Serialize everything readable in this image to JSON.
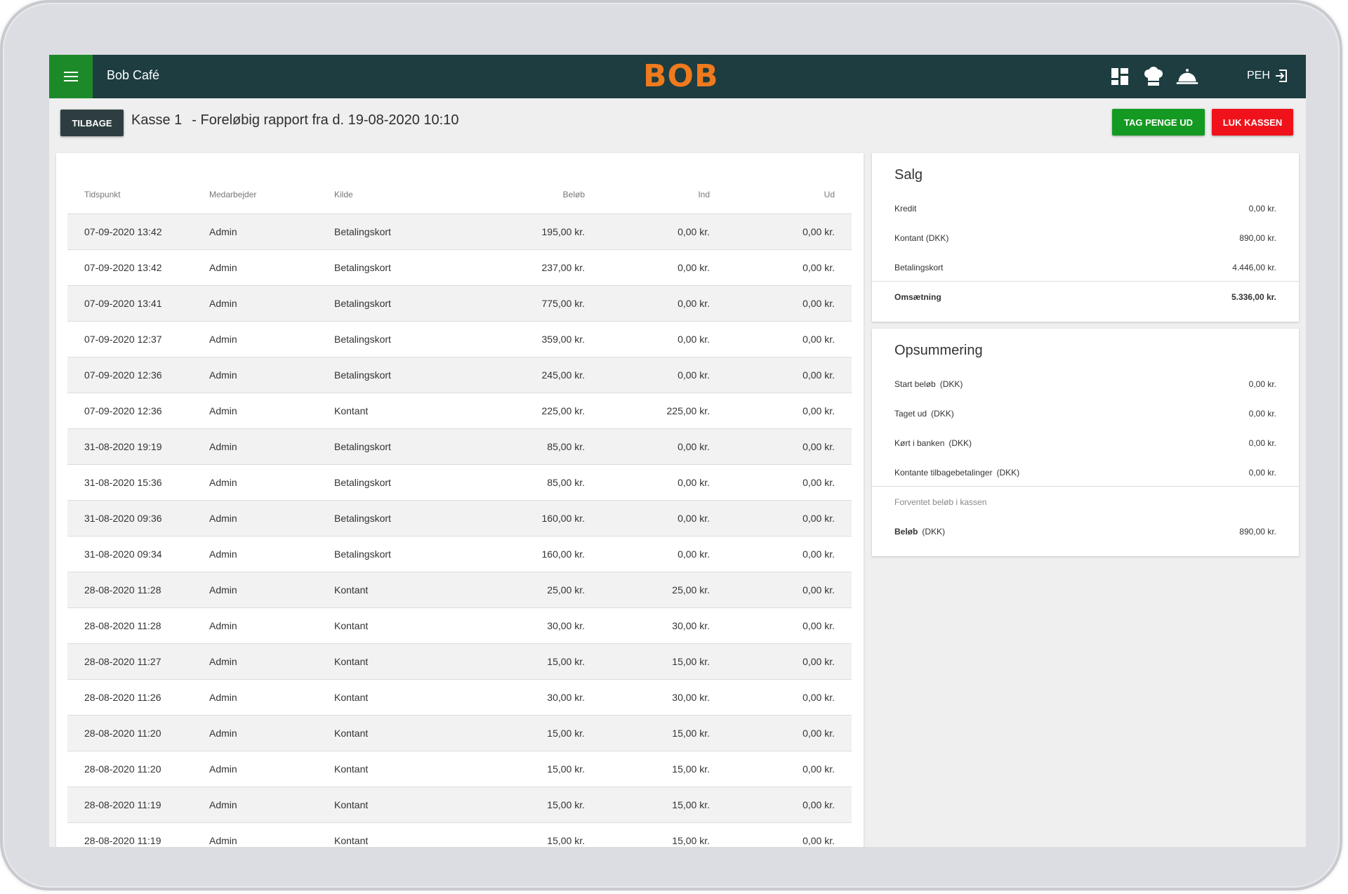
{
  "app": {
    "title": "Bob Café",
    "logo": "BOB",
    "user": "PEH",
    "icons": [
      "dashboard-icon",
      "chef-hat-icon",
      "service-bell-icon",
      "logout-icon"
    ]
  },
  "header": {
    "back_label": "TILBAGE",
    "register": "Kasse 1",
    "report_title": "- Foreløbig rapport fra d. 19-08-2020 10:10",
    "take_money_label": "TAG PENGE UD",
    "close_register_label": "LUK KASSEN"
  },
  "colors": {
    "topbar": "#1d3d40",
    "menu_button": "#1d8a2a",
    "logo": "#f07a1e",
    "green_button": "#149a22",
    "red_button": "#f0121b"
  },
  "table": {
    "columns": [
      "Tidspunkt",
      "Medarbejder",
      "Kilde",
      "Beløb",
      "Ind",
      "Ud"
    ],
    "rows": [
      {
        "time": "07-09-2020 13:42",
        "employee": "Admin",
        "source": "Betalingskort",
        "amount": "195,00 kr.",
        "in": "0,00 kr.",
        "out": "0,00 kr."
      },
      {
        "time": "07-09-2020 13:42",
        "employee": "Admin",
        "source": "Betalingskort",
        "amount": "237,00 kr.",
        "in": "0,00 kr.",
        "out": "0,00 kr."
      },
      {
        "time": "07-09-2020 13:41",
        "employee": "Admin",
        "source": "Betalingskort",
        "amount": "775,00 kr.",
        "in": "0,00 kr.",
        "out": "0,00 kr."
      },
      {
        "time": "07-09-2020 12:37",
        "employee": "Admin",
        "source": "Betalingskort",
        "amount": "359,00 kr.",
        "in": "0,00 kr.",
        "out": "0,00 kr."
      },
      {
        "time": "07-09-2020 12:36",
        "employee": "Admin",
        "source": "Betalingskort",
        "amount": "245,00 kr.",
        "in": "0,00 kr.",
        "out": "0,00 kr."
      },
      {
        "time": "07-09-2020 12:36",
        "employee": "Admin",
        "source": "Kontant",
        "amount": "225,00 kr.",
        "in": "225,00 kr.",
        "out": "0,00 kr."
      },
      {
        "time": "31-08-2020 19:19",
        "employee": "Admin",
        "source": "Betalingskort",
        "amount": "85,00 kr.",
        "in": "0,00 kr.",
        "out": "0,00 kr."
      },
      {
        "time": "31-08-2020 15:36",
        "employee": "Admin",
        "source": "Betalingskort",
        "amount": "85,00 kr.",
        "in": "0,00 kr.",
        "out": "0,00 kr."
      },
      {
        "time": "31-08-2020 09:36",
        "employee": "Admin",
        "source": "Betalingskort",
        "amount": "160,00 kr.",
        "in": "0,00 kr.",
        "out": "0,00 kr."
      },
      {
        "time": "31-08-2020 09:34",
        "employee": "Admin",
        "source": "Betalingskort",
        "amount": "160,00 kr.",
        "in": "0,00 kr.",
        "out": "0,00 kr."
      },
      {
        "time": "28-08-2020 11:28",
        "employee": "Admin",
        "source": "Kontant",
        "amount": "25,00 kr.",
        "in": "25,00 kr.",
        "out": "0,00 kr."
      },
      {
        "time": "28-08-2020 11:28",
        "employee": "Admin",
        "source": "Kontant",
        "amount": "30,00 kr.",
        "in": "30,00 kr.",
        "out": "0,00 kr."
      },
      {
        "time": "28-08-2020 11:27",
        "employee": "Admin",
        "source": "Kontant",
        "amount": "15,00 kr.",
        "in": "15,00 kr.",
        "out": "0,00 kr."
      },
      {
        "time": "28-08-2020 11:26",
        "employee": "Admin",
        "source": "Kontant",
        "amount": "30,00 kr.",
        "in": "30,00 kr.",
        "out": "0,00 kr."
      },
      {
        "time": "28-08-2020 11:20",
        "employee": "Admin",
        "source": "Kontant",
        "amount": "15,00 kr.",
        "in": "15,00 kr.",
        "out": "0,00 kr."
      },
      {
        "time": "28-08-2020 11:20",
        "employee": "Admin",
        "source": "Kontant",
        "amount": "15,00 kr.",
        "in": "15,00 kr.",
        "out": "0,00 kr."
      },
      {
        "time": "28-08-2020 11:19",
        "employee": "Admin",
        "source": "Kontant",
        "amount": "15,00 kr.",
        "in": "15,00 kr.",
        "out": "0,00 kr."
      },
      {
        "time": "28-08-2020 11:19",
        "employee": "Admin",
        "source": "Kontant",
        "amount": "15,00 kr.",
        "in": "15,00 kr.",
        "out": "0,00 kr."
      }
    ]
  },
  "sales": {
    "title": "Salg",
    "items": [
      {
        "label": "Kredit",
        "value": "0,00 kr."
      },
      {
        "label": "Kontant (DKK)",
        "value": "890,00 kr."
      },
      {
        "label": "Betalingskort",
        "value": "4.446,00 kr."
      }
    ],
    "total_label": "Omsætning",
    "total_value": "5.336,00 kr."
  },
  "summary": {
    "title": "Opsummering",
    "items": [
      {
        "label": "Start beløb",
        "unit": "(DKK)",
        "value": "0,00 kr."
      },
      {
        "label": "Taget ud",
        "unit": "(DKK)",
        "value": "0,00 kr."
      },
      {
        "label": "Kørt i banken",
        "unit": "(DKK)",
        "value": "0,00 kr."
      },
      {
        "label": "Kontante tilbagebetalinger",
        "unit": "(DKK)",
        "value": "0,00 kr."
      }
    ],
    "expected_note": "Forventet beløb i kassen",
    "amount_label": "Beløb",
    "amount_unit": "(DKK)",
    "amount_value": "890,00 kr."
  }
}
